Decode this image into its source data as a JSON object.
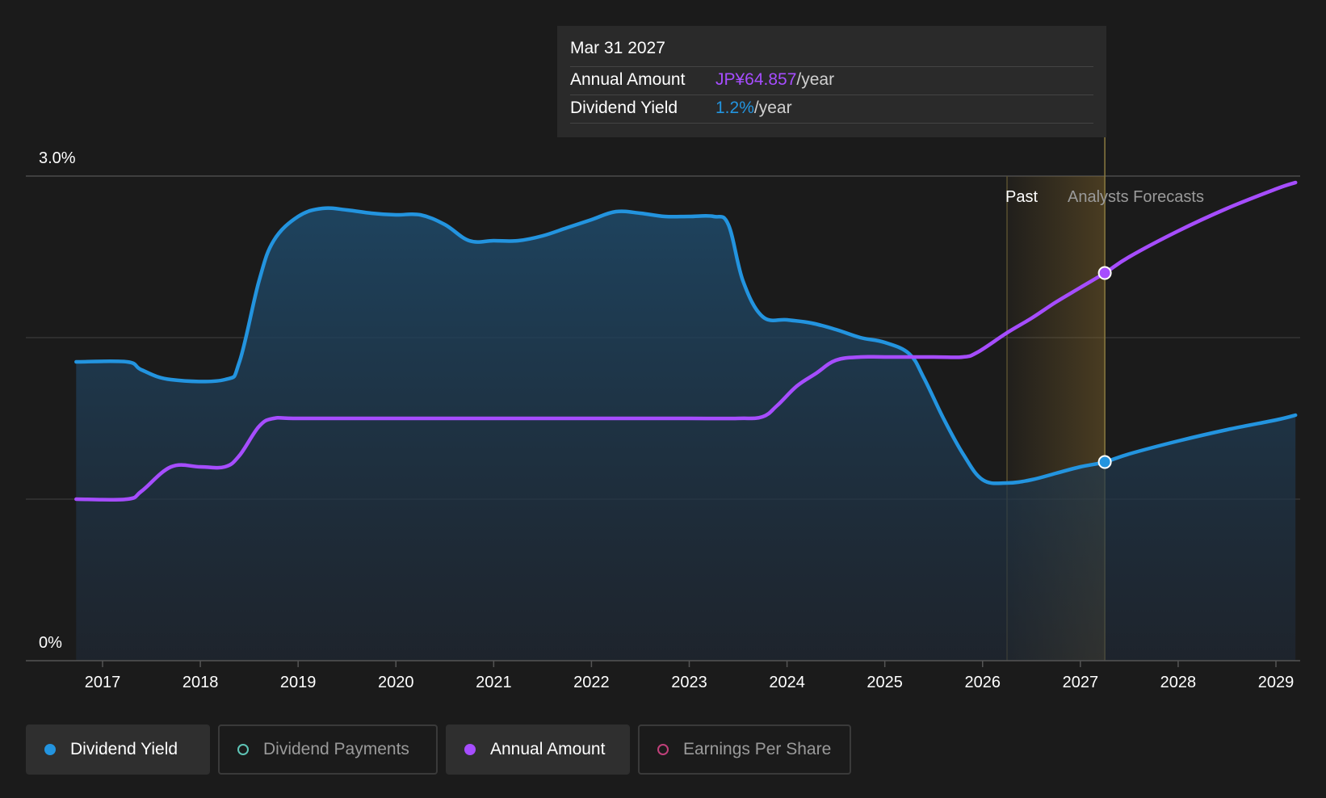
{
  "tooltip": {
    "date": "Mar 31 2027",
    "annual_label": "Annual Amount",
    "annual_value": "JP¥64.857",
    "annual_unit": "/year",
    "yield_label": "Dividend Yield",
    "yield_value": "1.2%",
    "yield_unit": "/year"
  },
  "regions": {
    "past_label": "Past",
    "forecast_label": "Analysts Forecasts"
  },
  "legend": [
    {
      "label": "Dividend Yield",
      "color": "#2394df",
      "active": true
    },
    {
      "label": "Dividend Payments",
      "color": "#5ec4b6",
      "active": false
    },
    {
      "label": "Annual Amount",
      "color": "#a64dff",
      "active": true
    },
    {
      "label": "Earnings Per Share",
      "color": "#c0407a",
      "active": false
    }
  ],
  "colors": {
    "background": "#1b1b1b",
    "yield_line": "#2394df",
    "annual_line": "#a64dff",
    "grid": "#3a3a3a",
    "forecast_band": "#b08a3a"
  },
  "chart_data": {
    "type": "line",
    "x_ticks": [
      "2017",
      "2018",
      "2019",
      "2020",
      "2021",
      "2022",
      "2023",
      "2024",
      "2025",
      "2026",
      "2027",
      "2028",
      "2029"
    ],
    "y_ticks": [
      "0%",
      "3.0%"
    ],
    "ylim": [
      0,
      3.0
    ],
    "xlim": [
      2016.2,
      2029.2
    ],
    "grid_lines": [
      1.0,
      2.0,
      3.0
    ],
    "past_end": 2026.25,
    "tooltip_x": 2027.25,
    "series": [
      {
        "name": "Dividend Yield",
        "unit": "%",
        "area_fill": true,
        "points": [
          [
            2016.73,
            1.85
          ],
          [
            2017.25,
            1.85
          ],
          [
            2017.4,
            1.8
          ],
          [
            2017.7,
            1.74
          ],
          [
            2018.25,
            1.74
          ],
          [
            2018.4,
            1.85
          ],
          [
            2018.6,
            2.35
          ],
          [
            2018.75,
            2.6
          ],
          [
            2019.0,
            2.75
          ],
          [
            2019.25,
            2.8
          ],
          [
            2019.5,
            2.79
          ],
          [
            2019.75,
            2.77
          ],
          [
            2020.0,
            2.76
          ],
          [
            2020.25,
            2.76
          ],
          [
            2020.5,
            2.7
          ],
          [
            2020.75,
            2.6
          ],
          [
            2021.0,
            2.6
          ],
          [
            2021.25,
            2.6
          ],
          [
            2021.5,
            2.63
          ],
          [
            2021.75,
            2.68
          ],
          [
            2022.0,
            2.73
          ],
          [
            2022.25,
            2.78
          ],
          [
            2022.5,
            2.77
          ],
          [
            2022.75,
            2.75
          ],
          [
            2023.0,
            2.75
          ],
          [
            2023.25,
            2.75
          ],
          [
            2023.4,
            2.7
          ],
          [
            2023.55,
            2.35
          ],
          [
            2023.75,
            2.13
          ],
          [
            2024.0,
            2.11
          ],
          [
            2024.25,
            2.09
          ],
          [
            2024.5,
            2.05
          ],
          [
            2024.75,
            2.0
          ],
          [
            2025.0,
            1.97
          ],
          [
            2025.25,
            1.9
          ],
          [
            2025.4,
            1.75
          ],
          [
            2025.6,
            1.5
          ],
          [
            2025.8,
            1.28
          ],
          [
            2026.0,
            1.12
          ],
          [
            2026.25,
            1.1
          ],
          [
            2026.5,
            1.12
          ],
          [
            2026.75,
            1.16
          ],
          [
            2027.0,
            1.2
          ],
          [
            2027.25,
            1.23
          ],
          [
            2027.5,
            1.28
          ],
          [
            2028.0,
            1.36
          ],
          [
            2028.5,
            1.43
          ],
          [
            2029.0,
            1.49
          ],
          [
            2029.2,
            1.52
          ]
        ]
      },
      {
        "name": "Annual Amount",
        "unit": "JP¥/year",
        "area_fill": false,
        "points": [
          [
            2016.73,
            1.0
          ],
          [
            2017.25,
            1.0
          ],
          [
            2017.4,
            1.05
          ],
          [
            2017.7,
            1.2
          ],
          [
            2018.0,
            1.2
          ],
          [
            2018.25,
            1.2
          ],
          [
            2018.4,
            1.27
          ],
          [
            2018.6,
            1.45
          ],
          [
            2018.75,
            1.5
          ],
          [
            2019.0,
            1.5
          ],
          [
            2020.0,
            1.5
          ],
          [
            2021.0,
            1.5
          ],
          [
            2022.0,
            1.5
          ],
          [
            2023.0,
            1.5
          ],
          [
            2023.5,
            1.5
          ],
          [
            2023.75,
            1.51
          ],
          [
            2023.9,
            1.58
          ],
          [
            2024.1,
            1.7
          ],
          [
            2024.3,
            1.78
          ],
          [
            2024.5,
            1.86
          ],
          [
            2024.75,
            1.88
          ],
          [
            2025.0,
            1.88
          ],
          [
            2025.5,
            1.88
          ],
          [
            2025.8,
            1.88
          ],
          [
            2025.95,
            1.91
          ],
          [
            2026.25,
            2.03
          ],
          [
            2026.5,
            2.12
          ],
          [
            2026.75,
            2.22
          ],
          [
            2027.0,
            2.31
          ],
          [
            2027.25,
            2.4
          ],
          [
            2027.5,
            2.5
          ],
          [
            2028.0,
            2.66
          ],
          [
            2028.5,
            2.8
          ],
          [
            2029.0,
            2.92
          ],
          [
            2029.2,
            2.96
          ]
        ]
      }
    ]
  }
}
